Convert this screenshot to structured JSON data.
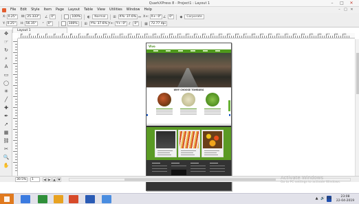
{
  "window": {
    "title": "QuarkXPress 8 - Project1 : Layout 1",
    "minimize_glyph": "–",
    "maximize_glyph": "□",
    "close_glyph": "✕"
  },
  "menu": {
    "items": [
      "File",
      "Edit",
      "Style",
      "Item",
      "Page",
      "Layout",
      "Table",
      "View",
      "Utilities",
      "Window",
      "Help"
    ],
    "right_controls": [
      "–",
      "□",
      "✕"
    ]
  },
  "measurements": {
    "x": "0.25\"",
    "y": "0.25\"",
    "w": "25.333\"",
    "h": "56.35\"",
    "angle": "0°",
    "shadow_angle": "0°",
    "percent_1": "100%",
    "percent_2": "100%",
    "blend": "Normal",
    "scale_x": "X%: 37.6%",
    "scale_y": "Y%: 37.6%",
    "offset_x": "X+: 0\"",
    "offset_y": "Y+: 0\"",
    "rot_1": "0°",
    "rot_2": "0°",
    "font": "Corporate",
    "resolution": "72.77 dpi"
  },
  "layout_tab": {
    "label": "Layout 1"
  },
  "ruler": {
    "labels": [
      "0",
      "1",
      "2",
      "3",
      "4",
      "5",
      "6",
      "7",
      "8",
      "9",
      "10",
      "11",
      "12",
      "13",
      "14",
      "15",
      "16",
      "17",
      "18",
      "19",
      "20",
      "21",
      "22",
      "23",
      "24",
      "25",
      "26",
      "27",
      "28",
      "29",
      "30",
      "31",
      "32",
      "33",
      "34",
      "35",
      "36",
      "37",
      "38",
      "39"
    ]
  },
  "page_preview": {
    "logo_text": "Vivo",
    "section_heading": "WHY CHOOSE TOMBURG"
  },
  "statusbar": {
    "zoom": "30.5%",
    "page": "1",
    "nav": [
      "◀",
      "▶",
      "▲",
      "▼"
    ]
  },
  "watermark": {
    "title": "Activate Windows",
    "subtitle": "Go to PC settings to activate Windows."
  },
  "taskbar": {
    "tray": [
      "▲",
      "🔊",
      "EN"
    ],
    "time": "23:08",
    "date": "22-04-2019"
  },
  "colors": {
    "brand_green": "#5a9a24",
    "nav_green": "#4f9a1c",
    "footer_dark": "#333333",
    "start_orange": "#e07a1f"
  },
  "icons": {
    "tools": [
      "item-tool-icon",
      "content-tool-icon",
      "rotation-tool-icon",
      "zoom-tool-icon",
      "text-box-tool-icon",
      "rectangle-tool-icon",
      "oval-tool-icon",
      "starburst-tool-icon",
      "line-tool-icon",
      "orthogonal-line-icon",
      "bezier-pen-icon",
      "text-path-icon",
      "table-tool-icon",
      "linking-tool-icon",
      "unlinking-tool-icon",
      "zoom-magnifier-icon",
      "pan-tool-icon"
    ]
  }
}
